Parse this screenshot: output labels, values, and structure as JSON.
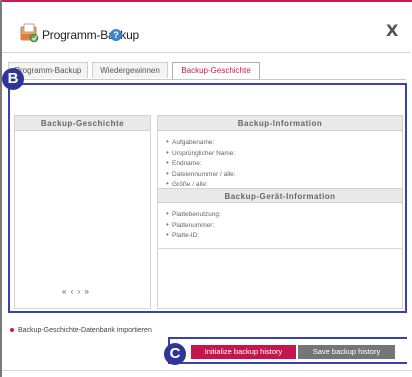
{
  "window": {
    "title": "Programm-Backup",
    "help_icon": "question-icon",
    "close_label": "X"
  },
  "tabs": [
    {
      "label": "Programm-Backup",
      "active": false
    },
    {
      "label": "Wiedergewinnen",
      "active": false
    },
    {
      "label": "Backup-Geschichte",
      "active": true
    }
  ],
  "annotations": {
    "b": "B",
    "c": "C"
  },
  "history_panel": {
    "heading": "Backup-Geschichte",
    "pager": "« ‹ › »"
  },
  "backup_info": {
    "heading": "Backup-Information",
    "items": [
      "Aufgabename:",
      "Ursprünglicher Name:",
      "Endname:",
      "Dateiennummer / alle:",
      "Größe / alle:"
    ]
  },
  "device_info": {
    "heading": "Backup-Gerät-Information",
    "items": [
      "Plattebenutzung:",
      "Plattenummer:",
      "Platte-ID:"
    ]
  },
  "import": {
    "label": "Backup-Geschichte-Datenbank importieren"
  },
  "buttons": {
    "initialize": "Initialize backup history",
    "save": "Save backup history"
  },
  "colors": {
    "accent": "#c8195a",
    "annotation": "#2f3699",
    "save_button": "#757575"
  }
}
